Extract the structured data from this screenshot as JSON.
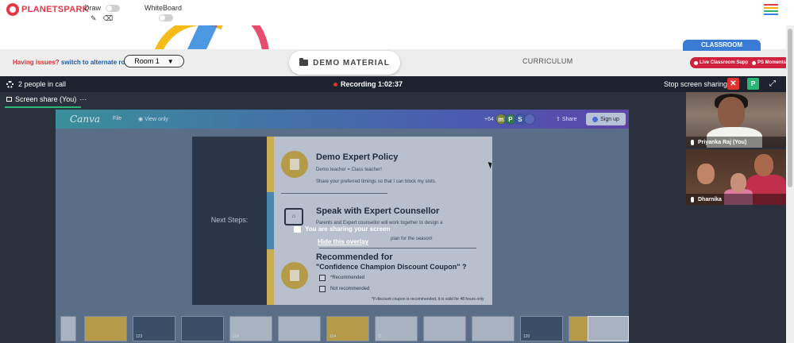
{
  "app": {
    "logo_text": "PLANETSPARK",
    "draw_label": "Draw",
    "whiteboard_label": "WhiteBoard",
    "menu_colors": [
      "#e63946",
      "#f4b400",
      "#2bb673",
      "#2e86de"
    ]
  },
  "tabs": {
    "issues_question": "Having issues?",
    "issues_link": "switch to alternate room",
    "room_selected": "Room 1",
    "demo_material": "DEMO MATERIAL",
    "curriculum": "CURRICULUM",
    "classroom": "CLASSROOM",
    "live_support": "Live Classroom Support",
    "ps_moments": "PS Moments"
  },
  "call": {
    "people": "2 people in call",
    "recording": "Recording 1:02:37",
    "stop_sharing": "Stop screen sharing",
    "close_glyph": "✕",
    "avatar_letter": "P",
    "expand_glyph": "⤢",
    "screen_share_tab": "Screen share (You)",
    "more_glyph": "···"
  },
  "canva": {
    "logo": "Canva",
    "file": "File",
    "view_only": "View only",
    "collab_count": "+64",
    "collab_letters": [
      "m",
      "P",
      "S"
    ],
    "share": "Share",
    "sign_up": "Sign up"
  },
  "slide": {
    "left_text": "Next Steps:",
    "section1_title": "Demo Expert Policy",
    "section1_line1": "Demo teacher = Class teacher!",
    "section1_line2": "Share your preferred timings so that I can block my slots.",
    "section2_title": "Speak with Expert Counsellor",
    "section2_line1": "Parents and Expert counsellor will work together to design a",
    "section2_line2": "plan for the season!",
    "section3_title": "Recommended for",
    "section3_subtitle": "\"Confidence Champion Discount Coupon\" ?",
    "option1": "*Recommended",
    "option2": "Not recommended",
    "footnote": "*If discount coupon is recommended, it is valid for 48 hours only"
  },
  "overlay": {
    "message": "You are sharing your screen",
    "hide": "Hide this overlay"
  },
  "thumbnails": [
    "",
    "",
    "123",
    "",
    "114",
    "",
    "114",
    "11",
    "",
    "",
    "120",
    "",
    ""
  ],
  "participants": [
    {
      "name": "Priyanka Raj (You)"
    },
    {
      "name": "Dharnika"
    }
  ]
}
